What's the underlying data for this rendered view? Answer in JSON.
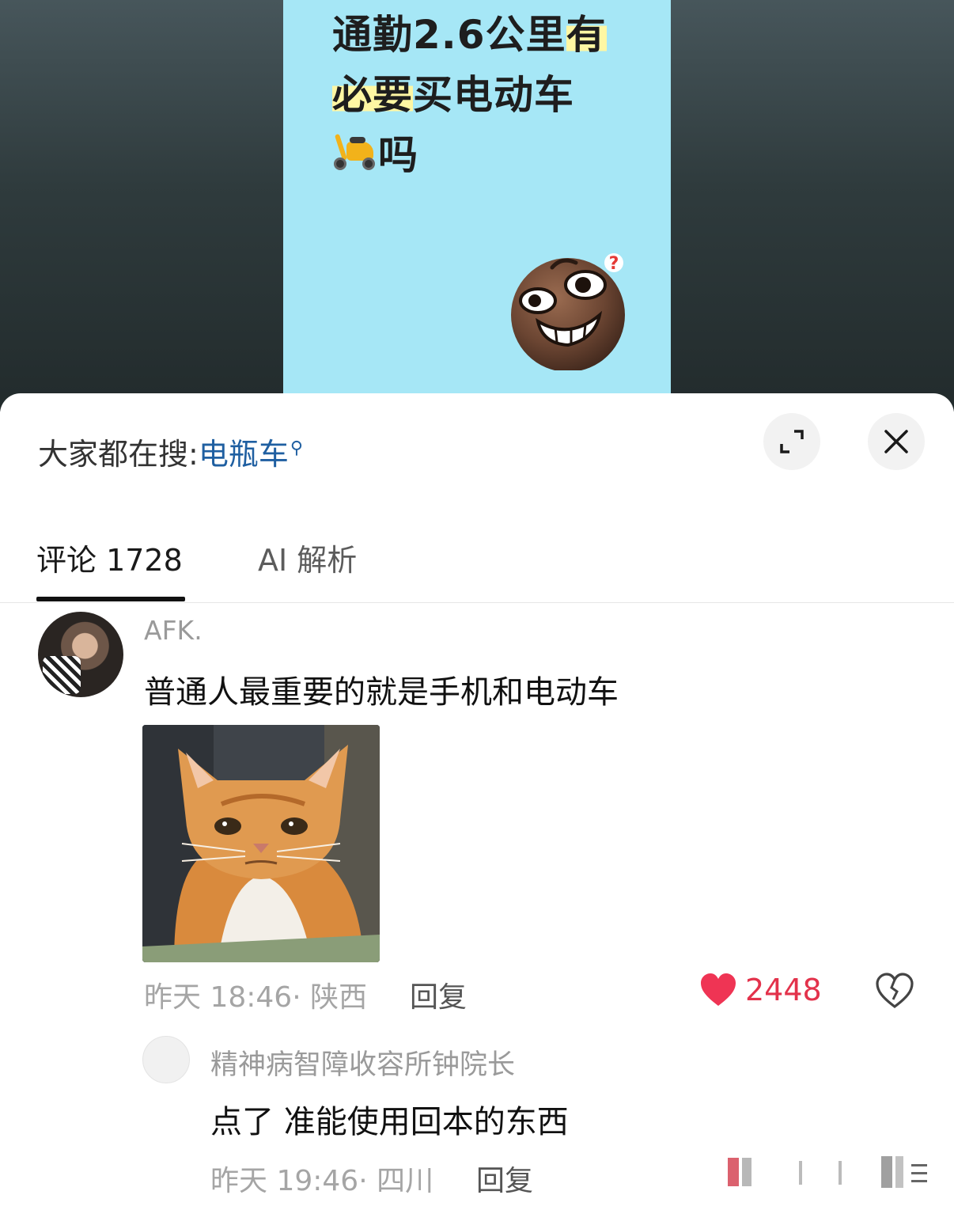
{
  "video": {
    "title_part1": "通勤2.6公里",
    "title_highlight1": "有",
    "title_highlight2": "必要",
    "title_part2": "买电动车",
    "title_part3": "吗",
    "panel_color": "#a6e7f6"
  },
  "search_hint": {
    "label": "大家都在搜:",
    "keyword": "电瓶车",
    "icon": "search-icon"
  },
  "header_buttons": {
    "expand_icon": "expand-icon",
    "close_icon": "close-icon"
  },
  "tabs": [
    {
      "label": "评论 1728",
      "active": true
    },
    {
      "label": "AI 解析",
      "active": false
    }
  ],
  "comment": {
    "username": "AFK.",
    "text": "普通人最重要的就是手机和电动车",
    "meta": "昨天 18:46· 陕西",
    "reply_label": "回复",
    "like_count": "2448",
    "liked": true,
    "accent": "#e3324b"
  },
  "reply": {
    "username": "精神病智障收容所钟院长",
    "text": "点了 准能使用回本的东西",
    "meta": "昨天 19:46· 四川",
    "reply_label": "回复"
  }
}
